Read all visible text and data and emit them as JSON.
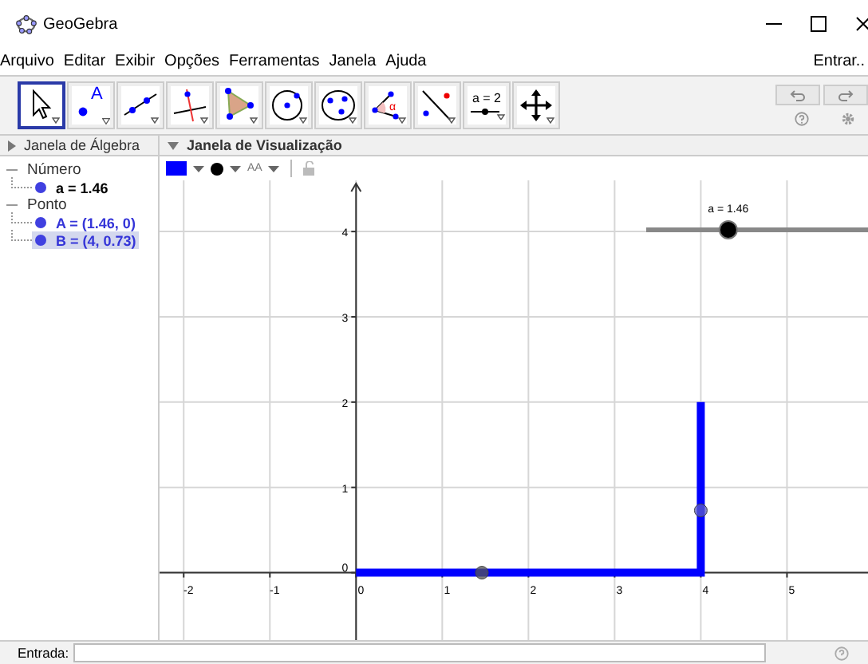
{
  "window": {
    "title": "GeoGebra"
  },
  "menu": [
    "Arquivo",
    "Editar",
    "Exibir",
    "Opções",
    "Ferramentas",
    "Janela",
    "Ajuda"
  ],
  "login": "Entrar..",
  "tools": [
    {
      "kind": "move",
      "selected": true
    },
    {
      "kind": "point",
      "label": "A",
      "selected": false
    },
    {
      "kind": "line",
      "selected": false
    },
    {
      "kind": "perpendicular",
      "selected": false
    },
    {
      "kind": "polygon",
      "selected": false
    },
    {
      "kind": "circle",
      "selected": false
    },
    {
      "kind": "conic",
      "selected": false
    },
    {
      "kind": "angle",
      "label": "α",
      "selected": false
    },
    {
      "kind": "reflect",
      "selected": false
    },
    {
      "kind": "slider",
      "label": "a = 2",
      "selected": false
    },
    {
      "kind": "move-view",
      "selected": false
    }
  ],
  "algebra": {
    "title": "Janela de Álgebra",
    "groups": [
      {
        "label": "Número",
        "kind": "number",
        "expanded": true,
        "children": [
          {
            "label": "a = 1.46",
            "selected": false
          }
        ]
      },
      {
        "label": "Ponto",
        "kind": "point",
        "expanded": true,
        "children": [
          {
            "label": "A = (1.46, 0)",
            "selected": false
          },
          {
            "label": "B = (4, 0.73)",
            "selected": true
          }
        ]
      }
    ]
  },
  "graphics": {
    "title": "Janela de Visualização",
    "text_size": "AA",
    "slider": {
      "label": "a = 1.46",
      "level": 0.37
    },
    "chart_data": {
      "type": "line",
      "x": [
        0,
        1.46,
        4,
        4,
        4
      ],
      "series": [
        {
          "color": "#0000ff",
          "values": [
            0,
            0,
            0,
            2,
            null
          ]
        },
        {
          "color": "#555555",
          "marker": "circle",
          "values": [
            null,
            0,
            null,
            null,
            null
          ]
        },
        {
          "color": "#5c5cc8",
          "marker": "circle",
          "values": [
            null,
            null,
            null,
            null,
            0.73
          ]
        }
      ],
      "grid": true,
      "xlim": [
        -2.28,
        5.94
      ],
      "ylim": [
        -0.79,
        4.6
      ],
      "xticks": [
        -2,
        -1,
        0,
        1,
        2,
        3,
        4,
        5
      ],
      "yticks": [
        0,
        1,
        2,
        3,
        4
      ]
    }
  },
  "input": {
    "label": "Entrada:"
  }
}
